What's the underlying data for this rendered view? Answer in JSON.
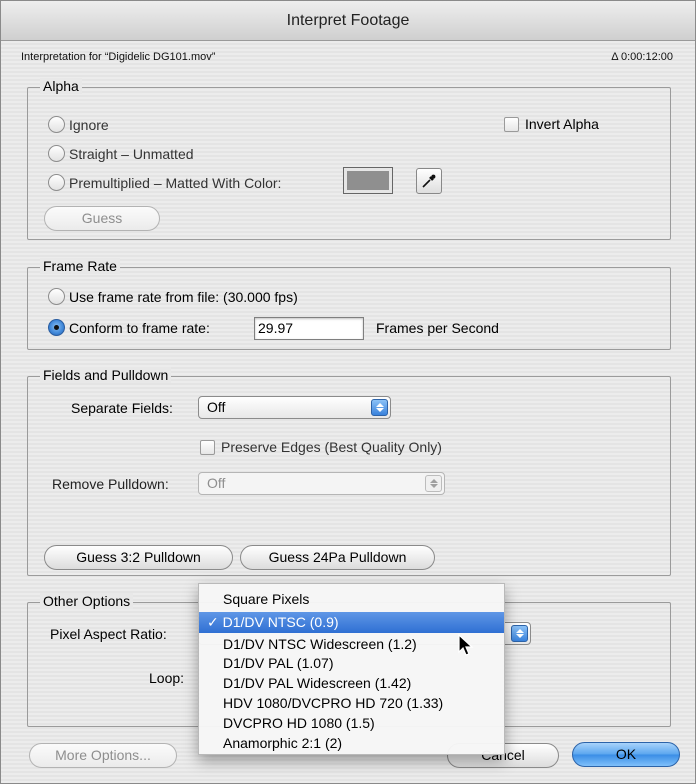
{
  "window": {
    "title": "Interpret Footage"
  },
  "info": {
    "interpretation_for": "Interpretation for “Digidelic DG101.mov”",
    "duration": "Δ 0:00:12:00"
  },
  "alpha": {
    "title": "Alpha",
    "ignore": "Ignore",
    "straight": "Straight – Unmatted",
    "premultiplied": "Premultiplied – Matted With Color:",
    "invert": "Invert Alpha",
    "guess": "Guess",
    "matte_color": "#8f8f8f"
  },
  "frame_rate": {
    "title": "Frame Rate",
    "use_file": "Use frame rate from file:  (30.000 fps)",
    "conform": "Conform to frame rate:",
    "value": "29.97",
    "unit": "Frames per Second"
  },
  "fields": {
    "title": "Fields and Pulldown",
    "separate_label": "Separate Fields:",
    "separate_value": "Off",
    "preserve_edges": "Preserve Edges (Best Quality Only)",
    "remove_label": "Remove Pulldown:",
    "remove_value": "Off",
    "guess_32": "Guess 3:2 Pulldown",
    "guess_24pa": "Guess 24Pa Pulldown"
  },
  "other": {
    "title": "Other Options",
    "pixel_aspect_label": "Pixel Aspect Ratio:",
    "loop_label": "Loop:"
  },
  "pixel_aspect_menu": {
    "items": [
      "Square Pixels",
      "✓ D1/DV NTSC (0.9)",
      "D1/DV NTSC Widescreen (1.2)",
      "D1/DV PAL (1.07)",
      "D1/DV PAL Widescreen (1.42)",
      "HDV 1080/DVCPRO HD 720 (1.33)",
      "DVCPRO HD 1080 (1.5)",
      "Anamorphic 2:1 (2)"
    ],
    "selected_index": 1
  },
  "buttons": {
    "more_options": "More Options...",
    "cancel": "Cancel",
    "ok": "OK"
  },
  "colors": {
    "accent": "#3a8de6",
    "selection": "#2f6fd3"
  }
}
